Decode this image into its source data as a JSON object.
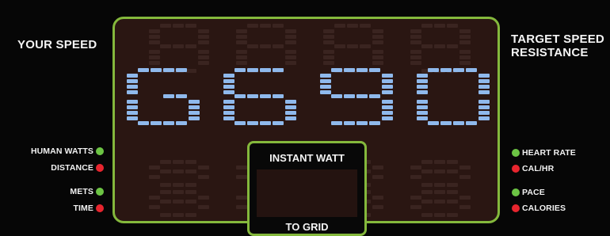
{
  "left_title": "YOUR SPEED",
  "right_title": [
    "TARGET SPEED",
    "RESISTANCE"
  ],
  "display": {
    "value": "G690",
    "digit_color": "#8fb9ec",
    "ghost_color": "#3a2420",
    "panel_color": "#2a1612",
    "border_color": "#84b83c"
  },
  "left_indicators": [
    {
      "label": "HUMAN WATTS",
      "color": "green"
    },
    {
      "label": "DISTANCE",
      "color": "red"
    },
    {
      "label": "METS",
      "color": "green"
    },
    {
      "label": "TIME",
      "color": "red"
    }
  ],
  "right_indicators": [
    {
      "label": "HEART RATE",
      "color": "green"
    },
    {
      "label": "CAL/HR",
      "color": "red"
    },
    {
      "label": "PACE",
      "color": "green"
    },
    {
      "label": "CALORIES",
      "color": "red"
    }
  ],
  "instant_box": {
    "title": "INSTANT WATT",
    "footer": "TO GRID"
  }
}
